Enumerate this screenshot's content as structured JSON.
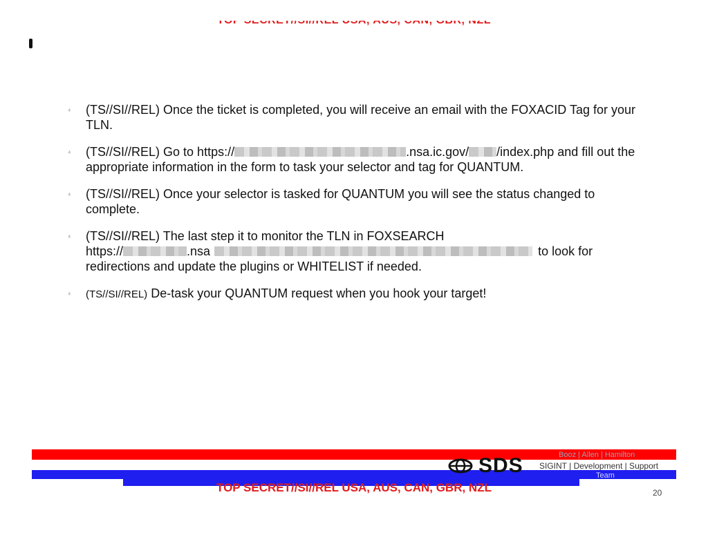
{
  "header": {
    "classification": "TOP SECRET//SI//REL USA, AUS, CAN, GBR, NZL"
  },
  "bullets": [
    {
      "classification": "(TS//SI//REL)",
      "text": "Once the ticket is completed, you will receive an email with the FOXACID Tag for your TLN."
    },
    {
      "classification": "(TS//SI//REL)",
      "text_a": "Go to https://",
      "text_b": ".nsa.ic.gov/",
      "text_c": "/index.php and fill out the appropriate information in the form to task your selector and tag for QUANTUM."
    },
    {
      "classification": "(TS//SI//REL)",
      "text": "Once your selector is tasked for QUANTUM you will see the status changed to complete."
    },
    {
      "classification": "(TS//SI//REL)",
      "text_a": "The last step it to monitor the TLN in FOXSEARCH",
      "text_b": "https://",
      "text_c": ".nsa",
      "text_d": "to look for redirections and update the plugins or WHITELIST if needed."
    },
    {
      "classification": "(TS//SI//REL)",
      "text": "De-task your QUANTUM request when you hook your target!"
    }
  ],
  "footer": {
    "classification": "TOP SECRET//SI//REL USA, AUS, CAN, GBR, NZL",
    "logo_text": "SDS",
    "company": "Booz | Allen | Hamilton",
    "tagline": "SIGINT | Development | Support",
    "team": "Team",
    "page_number": "20"
  },
  "colors": {
    "classification_red": "#e11d1d",
    "banner_red": "#ff0000",
    "banner_blue": "#1f1ff0"
  }
}
